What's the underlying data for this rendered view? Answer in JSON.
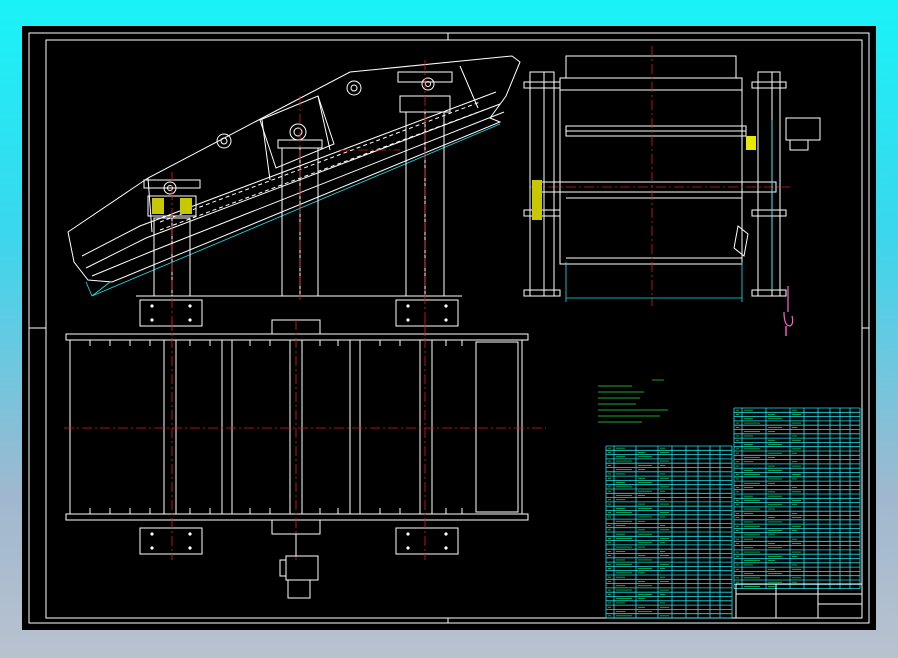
{
  "colors": {
    "frame_background": "#000000",
    "outer_gradient_top": "#19f3f7",
    "outer_gradient_bottom": "#b9c2cf",
    "linework": "#ffffff",
    "centerline": "#e01818",
    "dimension": "#19e6f0",
    "table_text": "#20e040",
    "highlight": "#e8e800",
    "lifting_hook": "#ff60d0"
  },
  "drawing": {
    "views": [
      "side-elevation",
      "end-elevation",
      "plan-view",
      "motor-detail"
    ],
    "icons": [
      "motor-icon",
      "bearing-icon",
      "lifting-hook-icon"
    ]
  }
}
